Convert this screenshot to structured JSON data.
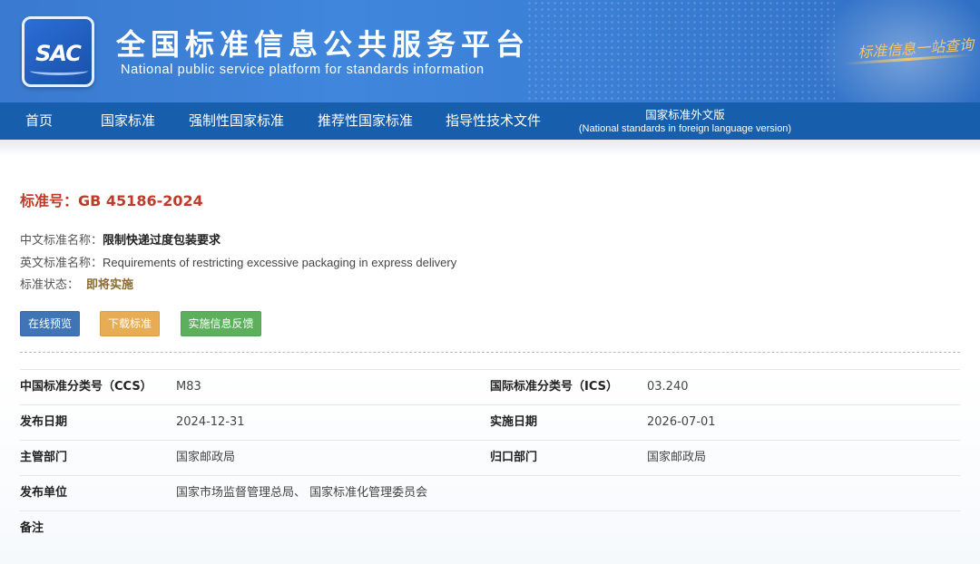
{
  "header": {
    "logo_text": "SAC",
    "title": "全国标准信息公共服务平台",
    "subtitle": "National public service platform  for standards information",
    "slogan": "标准信息一站查询"
  },
  "nav": {
    "items": [
      {
        "label": "首页"
      },
      {
        "label": "国家标准"
      },
      {
        "label": "强制性国家标准"
      },
      {
        "label": "推荐性国家标准"
      },
      {
        "label": "指导性技术文件"
      }
    ],
    "foreign": {
      "label_zh": "国家标准外文版",
      "label_en": "(National standards in foreign language version)"
    }
  },
  "standard": {
    "title_prefix": "标准号：",
    "code": "GB 45186-2024",
    "cn_name_label": "中文标准名称：",
    "cn_name": "限制快递过度包装要求",
    "en_name_label": "英文标准名称：",
    "en_name": "Requirements of restricting excessive packaging in express delivery",
    "status_label": "标准状态：",
    "status": "即将实施"
  },
  "buttons": {
    "preview": "在线预览",
    "download": "下载标准",
    "feedback": "实施信息反馈"
  },
  "details": {
    "ccs_label": "中国标准分类号（CCS）",
    "ccs": "M83",
    "ics_label": "国际标准分类号（ICS）",
    "ics": "03.240",
    "publish_date_label": "发布日期",
    "publish_date": "2024-12-31",
    "effective_date_label": "实施日期",
    "effective_date": "2026-07-01",
    "authority_label": "主管部门",
    "authority": "国家邮政局",
    "centralized_label": "归口部门",
    "centralized": "国家邮政局",
    "publisher_label": "发布单位",
    "publisher": "国家市场监督管理总局、 国家标准化管理委员会",
    "remarks_label": "备注",
    "remarks": ""
  },
  "colors": {
    "banner": "#3f86dc",
    "nav": "#175ead",
    "title_red": "#c0392b",
    "status_brown": "#8a6a2e",
    "btn_blue": "#3f75b5",
    "btn_orange": "#e8ad54",
    "btn_green": "#5cb05c"
  }
}
